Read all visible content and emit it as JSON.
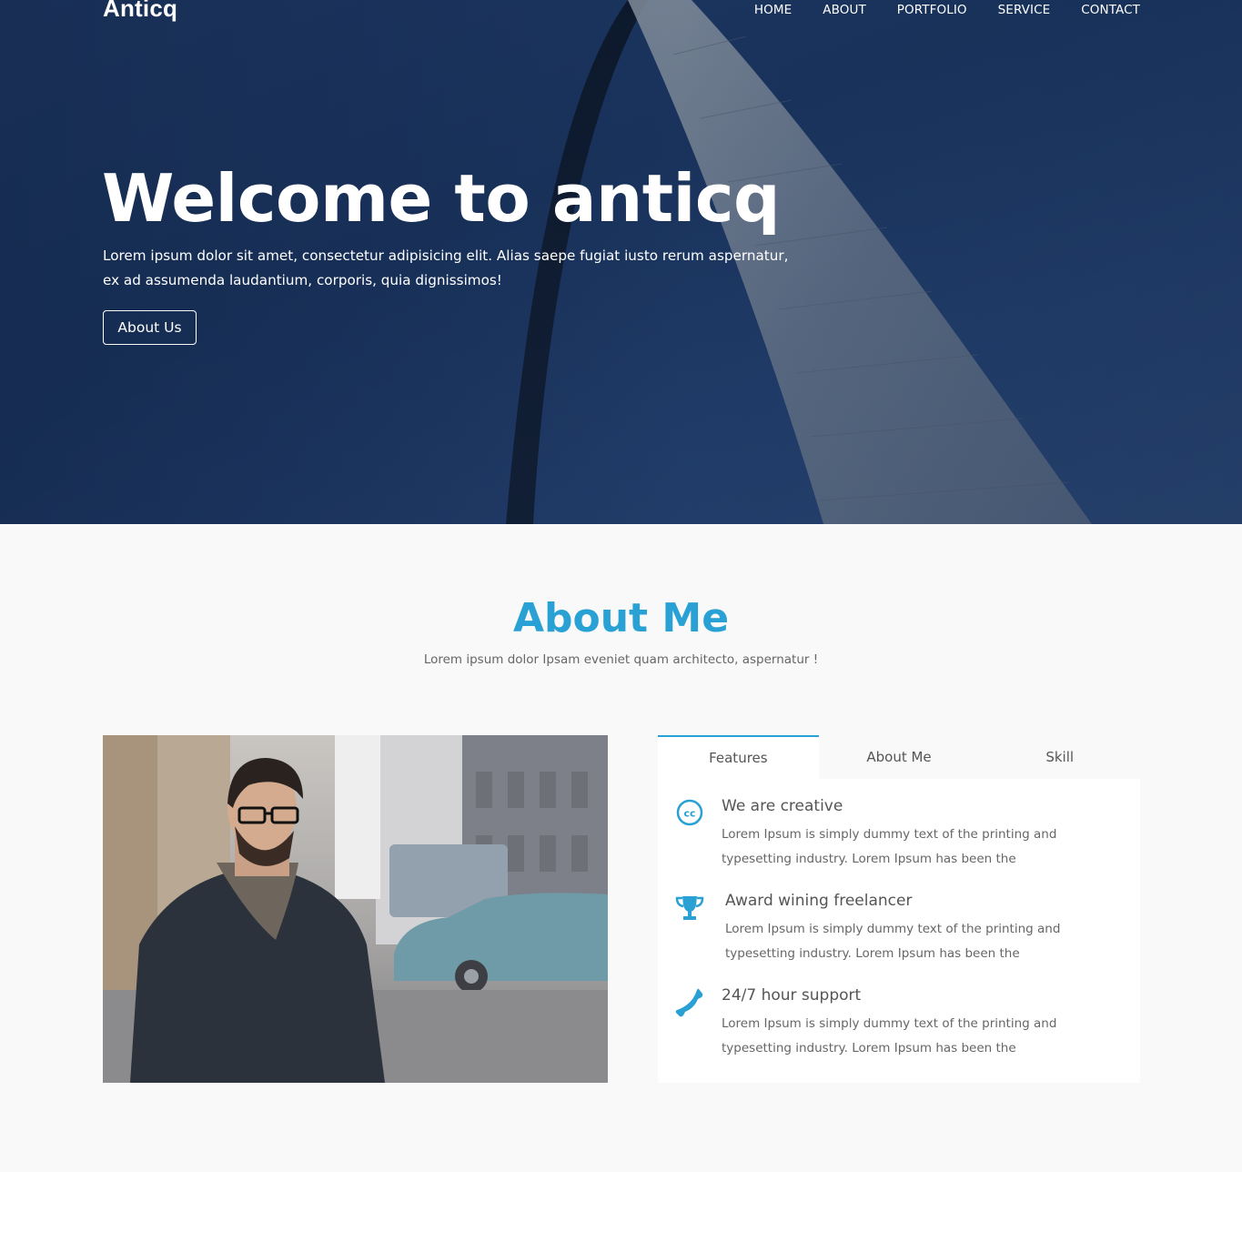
{
  "header": {
    "brand": "Anticq",
    "nav": [
      "HOME",
      "ABOUT",
      "PORTFOLIO",
      "SERVICE",
      "CONTACT"
    ]
  },
  "hero": {
    "title": "Welcome to anticq",
    "text": "Lorem ipsum dolor sit amet, consectetur adipisicing elit. Alias saepe fugiat iusto rerum aspernatur, ex ad assumenda laudantium, corporis, quia dignissimos!",
    "button": "About Us"
  },
  "about": {
    "title": "About Me",
    "subtitle": "Lorem ipsum dolor Ipsam eveniet quam architecto, aspernatur !",
    "tabs": [
      "Features",
      "About Me",
      "Skill"
    ],
    "active_tab": "Features",
    "features": [
      {
        "icon": "creative-commons-icon",
        "title": "We are creative",
        "text": "Lorem Ipsum is simply dummy text of the printing and typesetting industry. Lorem Ipsum has been the"
      },
      {
        "icon": "trophy-icon",
        "title": "Award wining freelancer",
        "text": "Lorem Ipsum is simply dummy text of the printing and typesetting industry. Lorem Ipsum has been the"
      },
      {
        "icon": "phone-icon",
        "title": "24/7 hour support",
        "text": "Lorem Ipsum is simply dummy text of the printing and typesetting industry. Lorem Ipsum has been the"
      }
    ]
  },
  "colors": {
    "accent": "#2aa1d4",
    "hero_bg": "#1d3862",
    "section_bg": "#f9f9f9"
  }
}
